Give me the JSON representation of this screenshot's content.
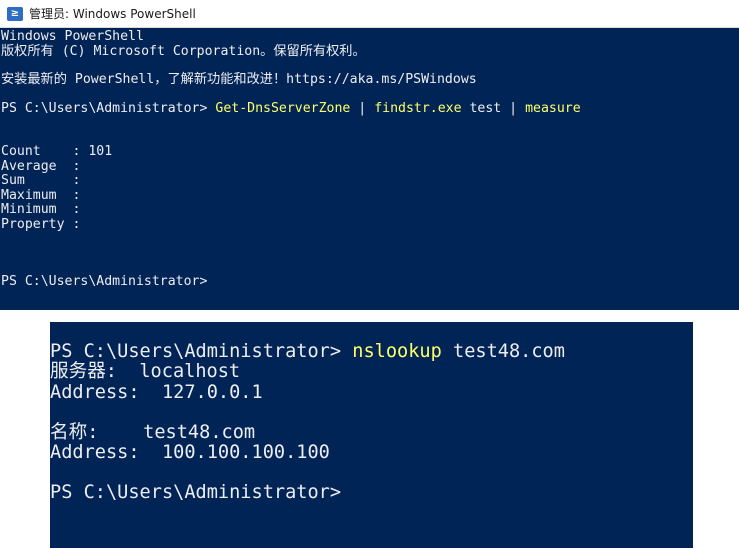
{
  "window": {
    "title": "管理员: Windows PowerShell",
    "icon": "powershell-icon",
    "icon_glyph": "≥"
  },
  "console1": {
    "banner": [
      "Windows PowerShell",
      "版权所有 (C) Microsoft Corporation。保留所有权利。"
    ],
    "install_hint": "安装最新的 PowerShell，了解新功能和改进！https://aka.ms/PSWindows",
    "prompt": "PS C:\\Users\\Administrator> ",
    "command": {
      "cmdlet": "Get-DnsServerZone",
      "pipe1": " | ",
      "filter": "findstr.exe",
      "filter_arg": " test",
      "pipe2": " | ",
      "measure": "measure"
    },
    "result": [
      "Count    : 101",
      "Average  :",
      "Sum      :",
      "Maximum  :",
      "Minimum  :",
      "Property :"
    ],
    "final_prompt": "PS C:\\Users\\Administrator>"
  },
  "console2": {
    "prompt": "PS C:\\Users\\Administrator> ",
    "command": "nslookup",
    "command_arg": " test48.com",
    "server_lines": [
      "服务器:  localhost",
      "Address:  127.0.0.1"
    ],
    "answer_lines": [
      "名称:    test48.com",
      "Address:  100.100.100.100"
    ],
    "final_prompt": "PS C:\\Users\\Administrator>"
  },
  "colors": {
    "console_bg": "#012456",
    "console_text": "#eeedf0",
    "command_highlight": "#ffff66"
  }
}
